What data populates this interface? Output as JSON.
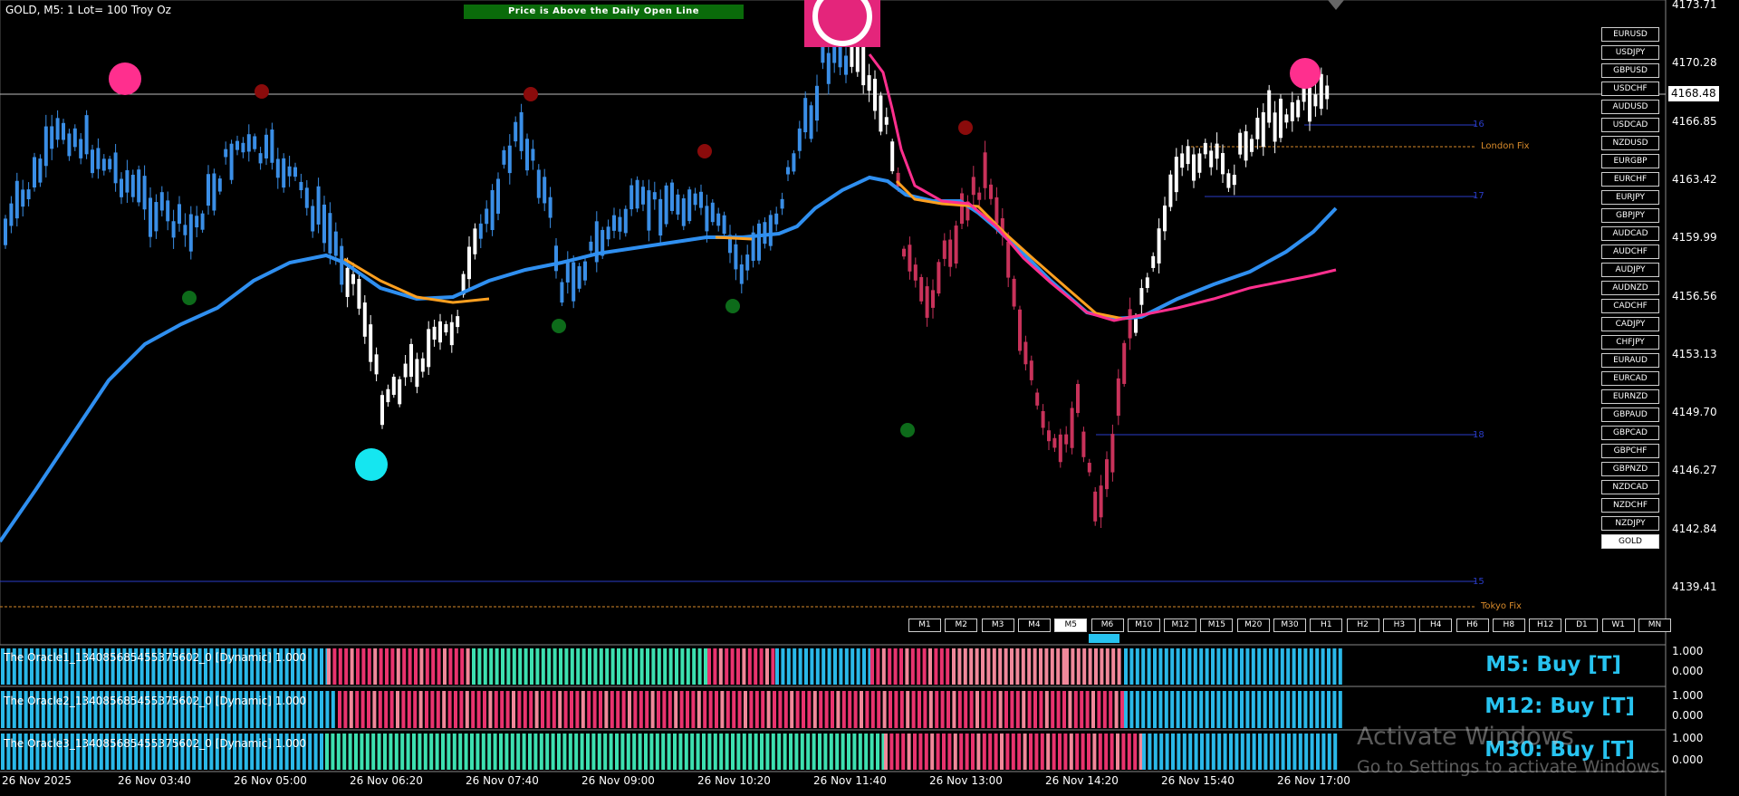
{
  "header": {
    "symbol_info": "GOLD, M5:  1 Lot= 100 Troy Oz",
    "banner": "Price is Above the Daily Open Line"
  },
  "price_axis": {
    "ticks": [
      "4173.71",
      "4170.28",
      "4166.85",
      "4163.42",
      "4159.99",
      "4156.56",
      "4153.13",
      "4149.70",
      "4146.27",
      "4142.84",
      "4139.41"
    ],
    "current": "4168.48"
  },
  "symbols": [
    "EURUSD",
    "USDJPY",
    "GBPUSD",
    "USDCHF",
    "AUDUSD",
    "USDCAD",
    "NZDUSD",
    "EURGBP",
    "EURCHF",
    "EURJPY",
    "GBPJPY",
    "AUDCAD",
    "AUDCHF",
    "AUDJPY",
    "AUDNZD",
    "CADCHF",
    "CADJPY",
    "CHFJPY",
    "EURAUD",
    "EURCAD",
    "EURNZD",
    "GBPAUD",
    "GBPCAD",
    "GBPCHF",
    "GBPNZD",
    "NZDCAD",
    "NZDCHF",
    "NZDJPY",
    "GOLD"
  ],
  "active_symbol": "GOLD",
  "timeframes": [
    "M1",
    "M2",
    "M3",
    "M4",
    "M5",
    "M6",
    "M10",
    "M12",
    "M15",
    "M20",
    "M30",
    "H1",
    "H2",
    "H3",
    "H4",
    "H6",
    "H8",
    "H12",
    "D1",
    "W1",
    "MN"
  ],
  "active_timeframe": "M5",
  "fix_labels": {
    "london": "London Fix",
    "tokyo": "Tokyo Fix"
  },
  "level_labels": [
    "16",
    "17",
    "18",
    "15"
  ],
  "indicators": [
    {
      "label": "The Oracle1_134085685455375602_0 [Dynamic] 1.000",
      "signal": "M5: Buy [T]",
      "scale_top": "1.000",
      "scale_bottom": "0.000"
    },
    {
      "label": "The Oracle2_134085685455375602_0 [Dynamic] 1.000",
      "signal": "M12: Buy [T]",
      "scale_top": "1.000",
      "scale_bottom": "0.000"
    },
    {
      "label": "The Oracle3_134085685455375602_0 [Dynamic] 1.000",
      "signal": "M30: Buy [T]",
      "scale_top": "1.000",
      "scale_bottom": "0.000"
    }
  ],
  "time_axis": [
    "26 Nov 2025",
    "26 Nov 03:40",
    "26 Nov 05:00",
    "26 Nov 06:20",
    "26 Nov 07:40",
    "26 Nov 09:00",
    "26 Nov 10:20",
    "26 Nov 11:40",
    "26 Nov 13:00",
    "26 Nov 14:20",
    "26 Nov 15:40",
    "26 Nov 17:00"
  ],
  "watermark": {
    "line1": "Activate Windows",
    "line2": "Go to Settings to activate Windows."
  },
  "colors": {
    "bull": "#3a8ee6",
    "bear": "#c8325a",
    "neutral": "#ffffff",
    "ma_blue": "#2f8ff0",
    "ma_orange": "#ffa020",
    "ma_pink": "#ff2f8e",
    "bar_green": "#3de0b0",
    "bar_pink": "#e8336e",
    "bar_salmon": "#f0889a",
    "bar_cyan": "#2ab8e8"
  }
}
